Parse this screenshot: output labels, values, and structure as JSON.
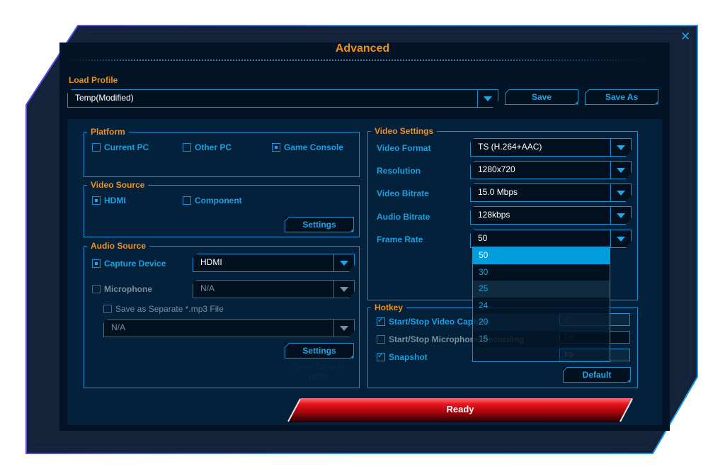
{
  "window": {
    "title": "Advanced",
    "close_icon": "close-x-icon"
  },
  "profile": {
    "label": "Load Profile",
    "value": "Temp(Modified)",
    "save_label": "Save",
    "save_as_label": "Save As"
  },
  "platform": {
    "legend": "Platform",
    "options": [
      {
        "label": "Current PC",
        "selected": false
      },
      {
        "label": "Other PC",
        "selected": false
      },
      {
        "label": "Game Console",
        "selected": true
      }
    ]
  },
  "video_source": {
    "legend": "Video Source",
    "options": [
      {
        "label": "HDMI",
        "selected": true
      },
      {
        "label": "Component",
        "selected": false
      }
    ],
    "settings_label": "Settings"
  },
  "audio_source": {
    "legend": "Audio Source",
    "capture_device": {
      "label": "Capture Device",
      "selected": true,
      "value": "HDMI"
    },
    "microphone": {
      "label": "Microphone",
      "selected": false,
      "value": "N/A"
    },
    "save_mp3": {
      "label": "Save as Separate *.mp3 File",
      "checked": false,
      "value": "N/A"
    },
    "settings_label": "Settings",
    "ghost_lines": [
      "Game Console",
      "HDMI"
    ]
  },
  "video_settings": {
    "legend": "Video Settings",
    "rows": [
      {
        "label": "Video Format",
        "value": "TS (H.264+AAC)"
      },
      {
        "label": "Resolution",
        "value": "1280x720"
      },
      {
        "label": "Video Bitrate",
        "value": "15.0 Mbps"
      },
      {
        "label": "Audio Bitrate",
        "value": "128kbps"
      },
      {
        "label": "Frame Rate",
        "value": "50"
      }
    ],
    "frame_rate_options": [
      "50",
      "30",
      "25",
      "24",
      "20",
      "15"
    ],
    "frame_rate_selected": "50"
  },
  "hotkey": {
    "legend": "Hotkey",
    "items": [
      {
        "label": "Start/Stop Video Capture",
        "checked": true,
        "key": "F7"
      },
      {
        "label": "Start/Stop Microphone Recording",
        "checked": false,
        "key": "F8"
      },
      {
        "label": "Snapshot",
        "checked": true,
        "key": "F9"
      }
    ],
    "default_label": "Default"
  },
  "status": {
    "label": "Ready"
  },
  "colors": {
    "accent_orange": "#f0901e",
    "accent_blue": "#1aa8ea",
    "ready_red": "#e8121c",
    "frame_bg": "#14223a"
  }
}
